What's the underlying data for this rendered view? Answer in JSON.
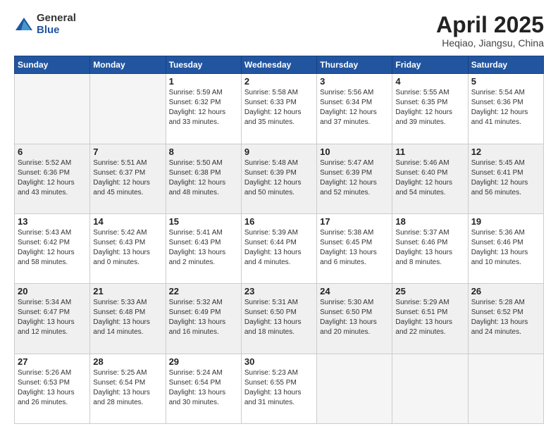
{
  "logo": {
    "general": "General",
    "blue": "Blue"
  },
  "header": {
    "title": "April 2025",
    "subtitle": "Heqiao, Jiangsu, China"
  },
  "weekdays": [
    "Sunday",
    "Monday",
    "Tuesday",
    "Wednesday",
    "Thursday",
    "Friday",
    "Saturday"
  ],
  "weeks": [
    [
      {
        "day": "",
        "info": ""
      },
      {
        "day": "",
        "info": ""
      },
      {
        "day": "1",
        "info": "Sunrise: 5:59 AM\nSunset: 6:32 PM\nDaylight: 12 hours and 33 minutes."
      },
      {
        "day": "2",
        "info": "Sunrise: 5:58 AM\nSunset: 6:33 PM\nDaylight: 12 hours and 35 minutes."
      },
      {
        "day": "3",
        "info": "Sunrise: 5:56 AM\nSunset: 6:34 PM\nDaylight: 12 hours and 37 minutes."
      },
      {
        "day": "4",
        "info": "Sunrise: 5:55 AM\nSunset: 6:35 PM\nDaylight: 12 hours and 39 minutes."
      },
      {
        "day": "5",
        "info": "Sunrise: 5:54 AM\nSunset: 6:36 PM\nDaylight: 12 hours and 41 minutes."
      }
    ],
    [
      {
        "day": "6",
        "info": "Sunrise: 5:52 AM\nSunset: 6:36 PM\nDaylight: 12 hours and 43 minutes."
      },
      {
        "day": "7",
        "info": "Sunrise: 5:51 AM\nSunset: 6:37 PM\nDaylight: 12 hours and 45 minutes."
      },
      {
        "day": "8",
        "info": "Sunrise: 5:50 AM\nSunset: 6:38 PM\nDaylight: 12 hours and 48 minutes."
      },
      {
        "day": "9",
        "info": "Sunrise: 5:48 AM\nSunset: 6:39 PM\nDaylight: 12 hours and 50 minutes."
      },
      {
        "day": "10",
        "info": "Sunrise: 5:47 AM\nSunset: 6:39 PM\nDaylight: 12 hours and 52 minutes."
      },
      {
        "day": "11",
        "info": "Sunrise: 5:46 AM\nSunset: 6:40 PM\nDaylight: 12 hours and 54 minutes."
      },
      {
        "day": "12",
        "info": "Sunrise: 5:45 AM\nSunset: 6:41 PM\nDaylight: 12 hours and 56 minutes."
      }
    ],
    [
      {
        "day": "13",
        "info": "Sunrise: 5:43 AM\nSunset: 6:42 PM\nDaylight: 12 hours and 58 minutes."
      },
      {
        "day": "14",
        "info": "Sunrise: 5:42 AM\nSunset: 6:43 PM\nDaylight: 13 hours and 0 minutes."
      },
      {
        "day": "15",
        "info": "Sunrise: 5:41 AM\nSunset: 6:43 PM\nDaylight: 13 hours and 2 minutes."
      },
      {
        "day": "16",
        "info": "Sunrise: 5:39 AM\nSunset: 6:44 PM\nDaylight: 13 hours and 4 minutes."
      },
      {
        "day": "17",
        "info": "Sunrise: 5:38 AM\nSunset: 6:45 PM\nDaylight: 13 hours and 6 minutes."
      },
      {
        "day": "18",
        "info": "Sunrise: 5:37 AM\nSunset: 6:46 PM\nDaylight: 13 hours and 8 minutes."
      },
      {
        "day": "19",
        "info": "Sunrise: 5:36 AM\nSunset: 6:46 PM\nDaylight: 13 hours and 10 minutes."
      }
    ],
    [
      {
        "day": "20",
        "info": "Sunrise: 5:34 AM\nSunset: 6:47 PM\nDaylight: 13 hours and 12 minutes."
      },
      {
        "day": "21",
        "info": "Sunrise: 5:33 AM\nSunset: 6:48 PM\nDaylight: 13 hours and 14 minutes."
      },
      {
        "day": "22",
        "info": "Sunrise: 5:32 AM\nSunset: 6:49 PM\nDaylight: 13 hours and 16 minutes."
      },
      {
        "day": "23",
        "info": "Sunrise: 5:31 AM\nSunset: 6:50 PM\nDaylight: 13 hours and 18 minutes."
      },
      {
        "day": "24",
        "info": "Sunrise: 5:30 AM\nSunset: 6:50 PM\nDaylight: 13 hours and 20 minutes."
      },
      {
        "day": "25",
        "info": "Sunrise: 5:29 AM\nSunset: 6:51 PM\nDaylight: 13 hours and 22 minutes."
      },
      {
        "day": "26",
        "info": "Sunrise: 5:28 AM\nSunset: 6:52 PM\nDaylight: 13 hours and 24 minutes."
      }
    ],
    [
      {
        "day": "27",
        "info": "Sunrise: 5:26 AM\nSunset: 6:53 PM\nDaylight: 13 hours and 26 minutes."
      },
      {
        "day": "28",
        "info": "Sunrise: 5:25 AM\nSunset: 6:54 PM\nDaylight: 13 hours and 28 minutes."
      },
      {
        "day": "29",
        "info": "Sunrise: 5:24 AM\nSunset: 6:54 PM\nDaylight: 13 hours and 30 minutes."
      },
      {
        "day": "30",
        "info": "Sunrise: 5:23 AM\nSunset: 6:55 PM\nDaylight: 13 hours and 31 minutes."
      },
      {
        "day": "",
        "info": ""
      },
      {
        "day": "",
        "info": ""
      },
      {
        "day": "",
        "info": ""
      }
    ]
  ]
}
